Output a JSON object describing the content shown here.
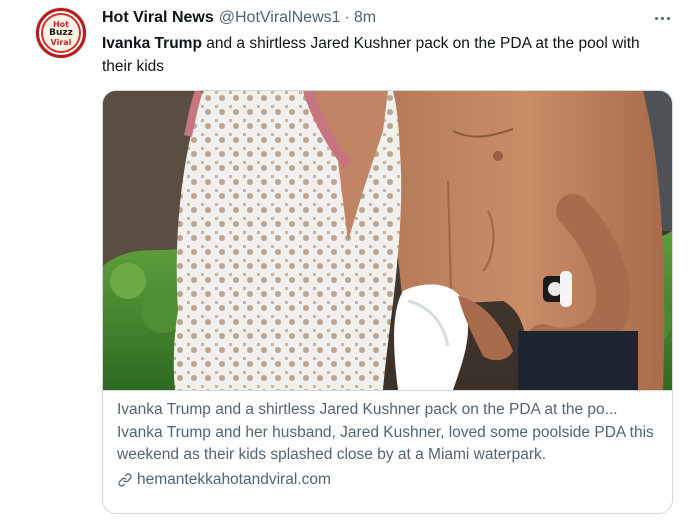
{
  "tweet": {
    "author_name": "Hot Viral News",
    "author_handle": "@HotViralNews1",
    "separator": "·",
    "time": "8m",
    "avatar": {
      "line1": "Hot",
      "line2": "Buzz",
      "line3": "Viral"
    },
    "text_bold": "Ivanka Trump",
    "text_rest": " and a shirtless Jared Kushner pack on the PDA at the pool with their kids",
    "more_icon": "more-horizontal-icon"
  },
  "card": {
    "title": "Ivanka Trump and a shirtless Jared Kushner pack on the PDA at the po...",
    "description": "Ivanka Trump and her husband, Jared Kushner, loved some poolside PDA this weekend as their kids splashed close by at a Miami waterpark.",
    "domain": "hemantekkahotandviral.com",
    "link_icon": "link-icon"
  },
  "colors": {
    "text_primary": "#0f1419",
    "text_secondary": "#536471",
    "border": "#cfd9de",
    "avatar_ring": "#b71c1c"
  }
}
